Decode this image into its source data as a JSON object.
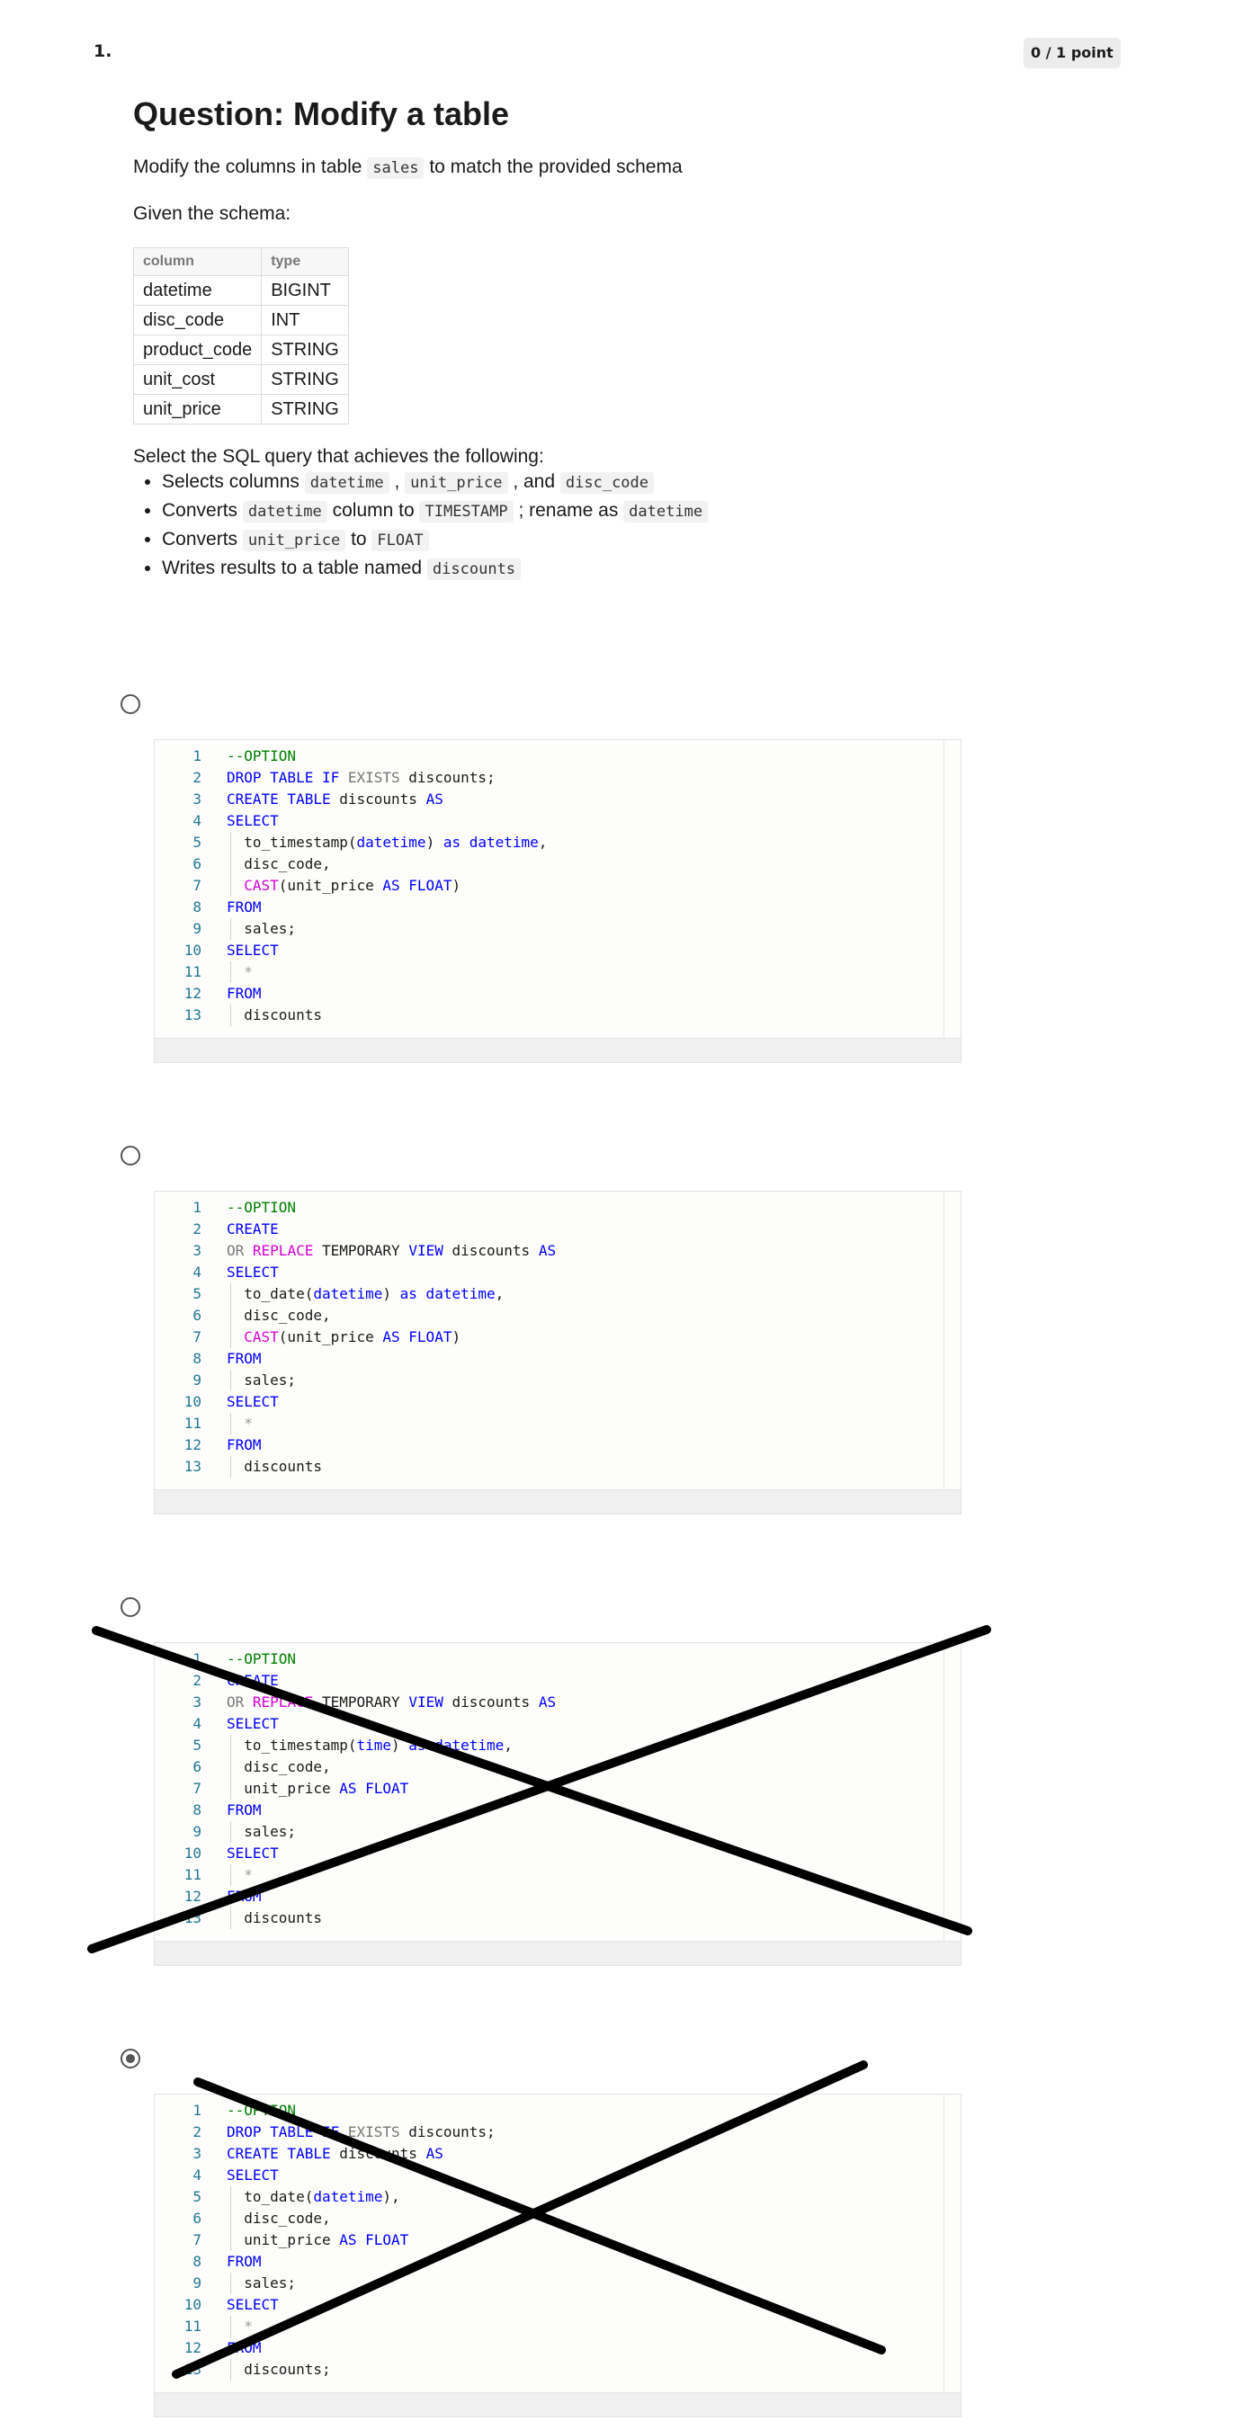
{
  "question": {
    "number": "1.",
    "points": "0 / 1 point",
    "title": "Question: Modify a table",
    "prompt_before": "Modify the columns in table ",
    "prompt_code": "sales",
    "prompt_after": " to match the provided schema",
    "given": "Given the schema:"
  },
  "schema": {
    "headers": [
      "column",
      "type"
    ],
    "rows": [
      [
        "datetime",
        "BIGINT"
      ],
      [
        "disc_code",
        "INT"
      ],
      [
        "product_code",
        "STRING"
      ],
      [
        "unit_cost",
        "STRING"
      ],
      [
        "unit_price",
        "STRING"
      ]
    ]
  },
  "task": {
    "intro": "Select the SQL query that achieves the following:",
    "items": [
      [
        {
          "t": "Selects columns "
        },
        {
          "c": "datetime"
        },
        {
          "t": " , "
        },
        {
          "c": "unit_price"
        },
        {
          "t": " , and "
        },
        {
          "c": "disc_code"
        }
      ],
      [
        {
          "t": "Converts "
        },
        {
          "c": "datetime"
        },
        {
          "t": " column to "
        },
        {
          "c": "TIMESTAMP"
        },
        {
          "t": " ; rename as "
        },
        {
          "c": "datetime"
        }
      ],
      [
        {
          "t": "Converts "
        },
        {
          "c": "unit_price"
        },
        {
          "t": " to "
        },
        {
          "c": "FLOAT"
        }
      ],
      [
        {
          "t": "Writes results to a table named "
        },
        {
          "c": "discounts"
        }
      ]
    ]
  },
  "options": [
    {
      "selected": false,
      "crossed": false,
      "lines": [
        [
          [
            "--OPTION",
            "comment"
          ]
        ],
        [
          [
            "DROP TABLE IF ",
            "kw"
          ],
          [
            "EXISTS",
            "gray"
          ],
          [
            " discounts;",
            "pun"
          ]
        ],
        [
          [
            "CREATE TABLE ",
            "kw"
          ],
          [
            "discounts ",
            "pun"
          ],
          [
            "AS",
            "kw"
          ]
        ],
        [
          [
            "SELECT",
            "kw"
          ]
        ],
        [
          [
            "  to_timestamp(",
            "pun"
          ],
          [
            "datetime",
            "kw"
          ],
          [
            ") ",
            "pun"
          ],
          [
            "as datetime",
            "kw"
          ],
          [
            ",",
            "pun"
          ]
        ],
        [
          [
            "  disc_code,",
            "pun"
          ]
        ],
        [
          [
            "  ",
            "pun"
          ],
          [
            "CAST",
            "fn"
          ],
          [
            "(unit_price ",
            "pun"
          ],
          [
            "AS FLOAT",
            "kw"
          ],
          [
            ")",
            "pun"
          ]
        ],
        [
          [
            "FROM",
            "kw"
          ]
        ],
        [
          [
            "  sales;",
            "pun"
          ]
        ],
        [
          [
            "SELECT",
            "kw"
          ]
        ],
        [
          [
            "  *",
            "star"
          ]
        ],
        [
          [
            "FROM",
            "kw"
          ]
        ],
        [
          [
            "  discounts",
            "pun"
          ]
        ]
      ]
    },
    {
      "selected": false,
      "crossed": false,
      "lines": [
        [
          [
            "--OPTION",
            "comment"
          ]
        ],
        [
          [
            "CREATE",
            "kw"
          ]
        ],
        [
          [
            "OR ",
            "gray"
          ],
          [
            "REPLACE",
            "fn"
          ],
          [
            " TEMPORARY ",
            "pun"
          ],
          [
            "VIEW",
            "kw"
          ],
          [
            " discounts ",
            "pun"
          ],
          [
            "AS",
            "kw"
          ]
        ],
        [
          [
            "SELECT",
            "kw"
          ]
        ],
        [
          [
            "  to_date(",
            "pun"
          ],
          [
            "datetime",
            "kw"
          ],
          [
            ") ",
            "pun"
          ],
          [
            "as datetime",
            "kw"
          ],
          [
            ",",
            "pun"
          ]
        ],
        [
          [
            "  disc_code,",
            "pun"
          ]
        ],
        [
          [
            "  ",
            "pun"
          ],
          [
            "CAST",
            "fn"
          ],
          [
            "(unit_price ",
            "pun"
          ],
          [
            "AS FLOAT",
            "kw"
          ],
          [
            ")",
            "pun"
          ]
        ],
        [
          [
            "FROM",
            "kw"
          ]
        ],
        [
          [
            "  sales;",
            "pun"
          ]
        ],
        [
          [
            "SELECT",
            "kw"
          ]
        ],
        [
          [
            "  *",
            "star"
          ]
        ],
        [
          [
            "FROM",
            "kw"
          ]
        ],
        [
          [
            "  discounts",
            "pun"
          ]
        ]
      ]
    },
    {
      "selected": false,
      "crossed": true,
      "lines": [
        [
          [
            "--OPTION",
            "comment"
          ]
        ],
        [
          [
            "CREATE",
            "kw"
          ]
        ],
        [
          [
            "OR ",
            "gray"
          ],
          [
            "REPLACE",
            "fn"
          ],
          [
            " TEMPORARY ",
            "pun"
          ],
          [
            "VIEW",
            "kw"
          ],
          [
            " discounts ",
            "pun"
          ],
          [
            "AS",
            "kw"
          ]
        ],
        [
          [
            "SELECT",
            "kw"
          ]
        ],
        [
          [
            "  to_timestamp(",
            "pun"
          ],
          [
            "time",
            "kw"
          ],
          [
            ") ",
            "pun"
          ],
          [
            "as datetime",
            "kw"
          ],
          [
            ",",
            "pun"
          ]
        ],
        [
          [
            "  disc_code,",
            "pun"
          ]
        ],
        [
          [
            "  unit_price ",
            "pun"
          ],
          [
            "AS FLOAT",
            "kw"
          ]
        ],
        [
          [
            "FROM",
            "kw"
          ]
        ],
        [
          [
            "  sales;",
            "pun"
          ]
        ],
        [
          [
            "SELECT",
            "kw"
          ]
        ],
        [
          [
            "  *",
            "star"
          ]
        ],
        [
          [
            "FROM",
            "kw"
          ]
        ],
        [
          [
            "  discounts",
            "pun"
          ]
        ]
      ]
    },
    {
      "selected": true,
      "crossed": true,
      "lines": [
        [
          [
            "--OPTION",
            "comment"
          ]
        ],
        [
          [
            "DROP TABLE IF ",
            "kw"
          ],
          [
            "EXISTS",
            "gray"
          ],
          [
            " discounts;",
            "pun"
          ]
        ],
        [
          [
            "CREATE TABLE ",
            "kw"
          ],
          [
            "discounts ",
            "pun"
          ],
          [
            "AS",
            "kw"
          ]
        ],
        [
          [
            "SELECT",
            "kw"
          ]
        ],
        [
          [
            "  to_date(",
            "pun"
          ],
          [
            "datetime",
            "kw"
          ],
          [
            "),",
            "pun"
          ]
        ],
        [
          [
            "  disc_code,",
            "pun"
          ]
        ],
        [
          [
            "  unit_price ",
            "pun"
          ],
          [
            "AS FLOAT",
            "kw"
          ]
        ],
        [
          [
            "FROM",
            "kw"
          ]
        ],
        [
          [
            "  sales;",
            "pun"
          ]
        ],
        [
          [
            "SELECT",
            "kw"
          ]
        ],
        [
          [
            "  *",
            "star"
          ]
        ],
        [
          [
            "FROM",
            "kw"
          ]
        ],
        [
          [
            "  discounts;",
            "pun"
          ]
        ]
      ]
    }
  ]
}
